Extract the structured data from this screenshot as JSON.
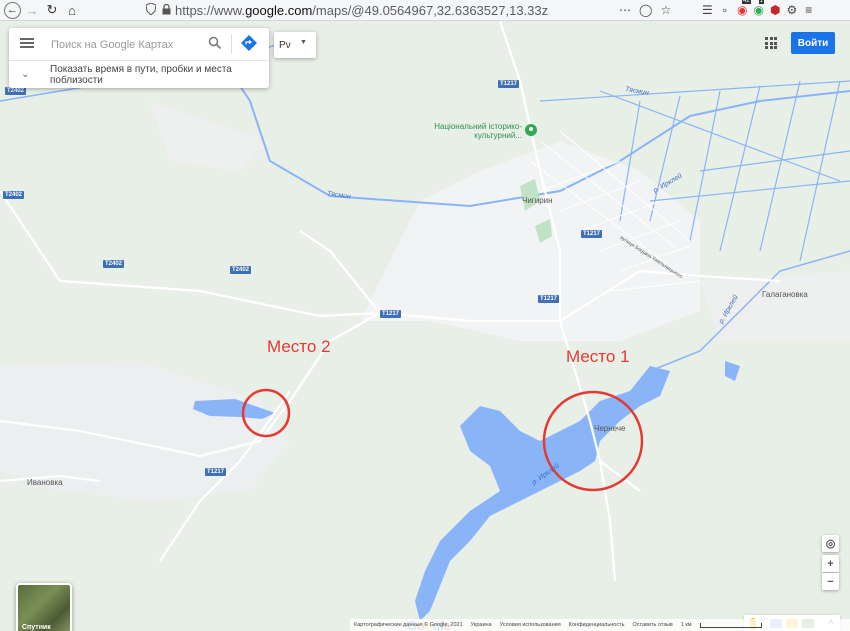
{
  "browser": {
    "url_prefix": "https://www.",
    "url_host": "google.com",
    "url_path": "/maps/@49.0564967,32.6363527,13.33z",
    "menu_dots": "⋯",
    "badge_counts": [
      "42",
      "1"
    ]
  },
  "search": {
    "placeholder": "Поиск на Google Картах",
    "travel_text": "Показать время в пути, пробки и места поблизости"
  },
  "lang_select": {
    "value": "Рν"
  },
  "header": {
    "signin_label": "Войти"
  },
  "map": {
    "place_labels": {
      "chyhyryn": "Чигирин",
      "halahanivka": "Галагановка",
      "cherneche": "Чернече",
      "ivanovka": "Ивановка",
      "street": "вулиця Богдана Хмельницького"
    },
    "poi": {
      "name": "Національний історико-культурний..."
    },
    "rivers": {
      "tyasmin": "Тясмин",
      "irkliy": "р. Ирклей"
    },
    "road_shields": {
      "t1217": "T1217",
      "t2402": "T2402"
    },
    "annotations": {
      "place1": "Место 1",
      "place2": "Место 2"
    },
    "satellite_label": "Спутник",
    "google_logo": [
      "G",
      "o",
      "o",
      "g",
      "l",
      "e"
    ]
  },
  "footer": {
    "items": [
      "Картографические данные © Google, 2021",
      "Украина",
      "Условия использования",
      "Конфиденциальность",
      "Оставить отзыв",
      "1 км"
    ]
  },
  "colors": {
    "land": "#e8efe6",
    "water": "#8ab4f8",
    "road": "#ffffff",
    "accent": "#1a73e8",
    "annotation": "#e53935",
    "google": [
      "#4285f4",
      "#ea4335",
      "#fbbc05",
      "#4285f4",
      "#34a853",
      "#ea4335"
    ]
  }
}
